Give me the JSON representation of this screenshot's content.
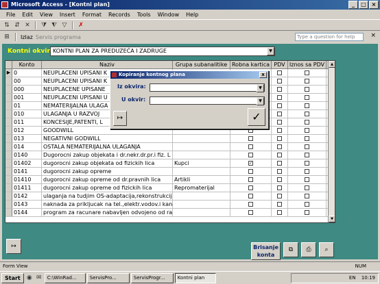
{
  "window": {
    "title": "Microsoft Access - [Kontni plan]",
    "buttons": [
      "_",
      "□",
      "×"
    ]
  },
  "menu": [
    "File",
    "Edit",
    "View",
    "Insert",
    "Format",
    "Records",
    "Tools",
    "Window",
    "Help"
  ],
  "toolbar2": {
    "izlaz": "Izlaz",
    "servis": "Servis programa",
    "help_placeholder": "Type a question for help"
  },
  "form": {
    "kontni_label": "Kontni okvir:",
    "kontni_value": "KONTNI PLAN ZA PREDUZEĆA I ZADRUGE",
    "columns": [
      "Konto",
      "Naziv",
      "Grupa subanalitike",
      "Robna kartica",
      "PDV",
      "Iznos sa PDV"
    ],
    "rows": [
      {
        "konto": "0",
        "naziv": "NEUPLACENI UPISANI K",
        "grupa": "",
        "robna": false
      },
      {
        "konto": "00",
        "naziv": "NEUPLACENI UPISANI K",
        "grupa": "",
        "robna": false
      },
      {
        "konto": "000",
        "naziv": "NEUPLACENE UPISANE",
        "grupa": "",
        "robna": false
      },
      {
        "konto": "001",
        "naziv": "NEUPLACENI UPISANI U",
        "grupa": "",
        "robna": false
      },
      {
        "konto": "01",
        "naziv": "NEMATERIJALNA ULAGA",
        "grupa": "",
        "robna": false
      },
      {
        "konto": "010",
        "naziv": "ULAGANJA U RAZVOJ",
        "grupa": "",
        "robna": false
      },
      {
        "konto": "011",
        "naziv": "KONCESIJE,PATENTI, L",
        "grupa": "",
        "robna": false
      },
      {
        "konto": "012",
        "naziv": "GOODWILL",
        "grupa": "",
        "robna": false
      },
      {
        "konto": "013",
        "naziv": "NEGATIVNI GODWILL",
        "grupa": "",
        "robna": false
      },
      {
        "konto": "014",
        "naziv": "OSTALA NEMATERIJALNA ULAGANJA",
        "grupa": "",
        "robna": false
      },
      {
        "konto": "0140",
        "naziv": "Dugorocni zakup objekata i dr.nekr.dr.pr.i fiz. L",
        "grupa": "",
        "robna": false
      },
      {
        "konto": "01402",
        "naziv": "dugorocni zakup objekata od fizickih lica",
        "grupa": "Kupci",
        "robna": true
      },
      {
        "konto": "0141",
        "naziv": "dugorocni zakup opreme",
        "grupa": "",
        "robna": false
      },
      {
        "konto": "01410",
        "naziv": "dugorocni zakup opreme od dr.pravnih lica",
        "grupa": "Artikli",
        "robna": false
      },
      {
        "konto": "01411",
        "naziv": "dugorocni zakup opreme od fizickih lica",
        "grupa": "Repromaterijal",
        "robna": false
      },
      {
        "konto": "0142",
        "naziv": "ulaganja na tudjim OS-adaptacija,rekonstrukcij",
        "grupa": "",
        "robna": false
      },
      {
        "konto": "0143",
        "naziv": "naknada za prikljucak na tel.,elektr.vodov.i kan",
        "grupa": "",
        "robna": false
      },
      {
        "konto": "0144",
        "naziv": "program za racunare nabavljen odvojeno od rac",
        "grupa": "",
        "robna": false
      }
    ]
  },
  "dialog": {
    "title": "Kopiranje kontnog plana",
    "iz_label": "Iz okvira:",
    "u_label": "U okvir:",
    "close": "x",
    "ok_glyph": "✓",
    "exit_glyph": "↦"
  },
  "bottom": {
    "brisanje": "Brisanje konta",
    "exit_glyph": "↦"
  },
  "status": {
    "left": "Form View",
    "right": "NUM"
  },
  "taskbar": {
    "start": "Start",
    "tasks": [
      "C:\\WinRad...",
      "ServisPro...",
      "ServisProgr...",
      "Kontni plan"
    ],
    "time": "10:19",
    "lang": "EN"
  }
}
